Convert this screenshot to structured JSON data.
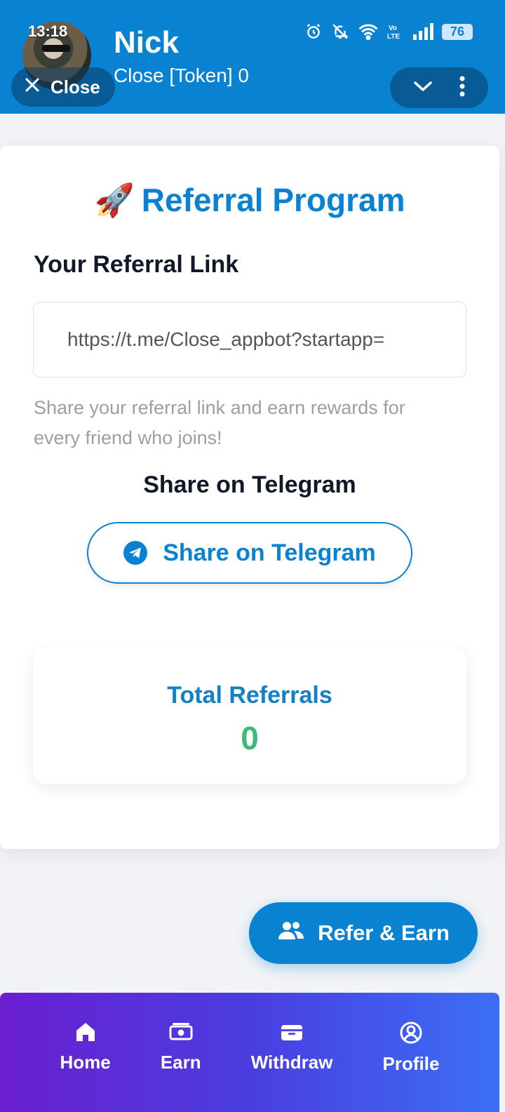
{
  "status_bar": {
    "time": "13:18",
    "battery": "76",
    "icons": [
      "alarm-icon",
      "mute-bell-icon",
      "wifi-icon",
      "volte-icon",
      "signal-icon",
      "battery-icon"
    ]
  },
  "header": {
    "name": "Nick",
    "subtitle": "Close [Token] 0",
    "close_label": "Close",
    "background_color": "#0a82d2"
  },
  "referral": {
    "title": "Referral Program",
    "title_emoji": "🚀",
    "link_label": "Your Referral Link",
    "link_value": "https://t.me/Close_appbot?startapp=",
    "hint": "Share your referral link and earn rewards for every friend who joins!",
    "share_heading": "Share on Telegram",
    "share_button": "Share on Telegram"
  },
  "stats": {
    "label": "Total Referrals",
    "value": "0"
  },
  "floating_button": {
    "label": "Refer & Earn"
  },
  "nav": {
    "items": [
      {
        "label": "Home",
        "icon": "home-icon"
      },
      {
        "label": "Earn",
        "icon": "money-icon"
      },
      {
        "label": "Withdraw",
        "icon": "wallet-icon"
      },
      {
        "label": "Profile",
        "icon": "user-circle-icon"
      }
    ]
  },
  "colors": {
    "accent": "#0a82d2",
    "success": "#3dbb77",
    "nav_gradient_start": "#6a1fd1",
    "nav_gradient_end": "#3b6ff5"
  }
}
